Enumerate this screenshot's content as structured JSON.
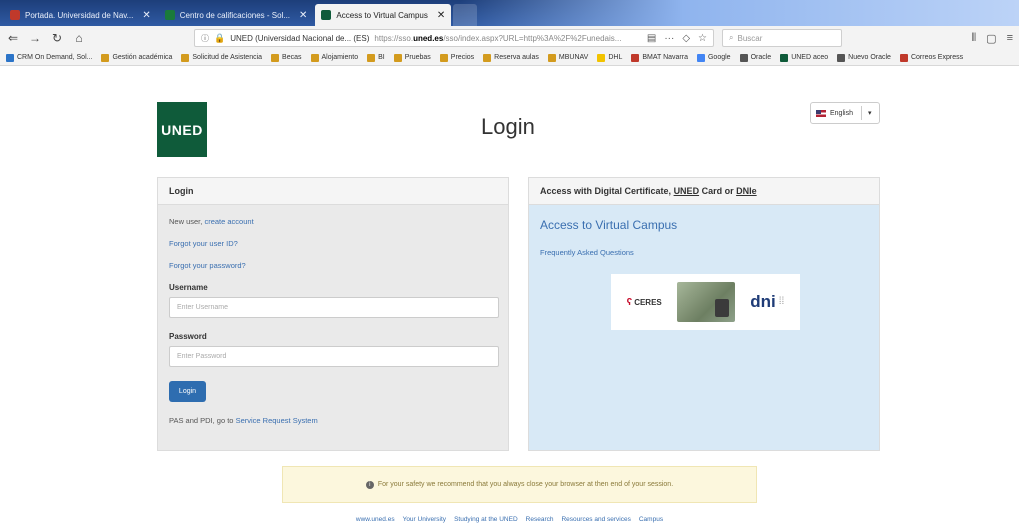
{
  "browser": {
    "tabs": [
      {
        "title": "Portada. Universidad de Nav...",
        "favicon_color": "#c0392b"
      },
      {
        "title": "Centro de calificaciones - Sol...",
        "favicon_color": "#1a7a3a"
      },
      {
        "title": "Access to Virtual Campus",
        "favicon_color": "#0f5b3a"
      }
    ],
    "url": {
      "site": "UNED (Universidad Nacional de... (ES)",
      "prefix": "https://sso.",
      "host": "uned.es",
      "path": "/sso/index.aspx?URL=http%3A%2F%2Funedais..."
    },
    "search_placeholder": "Buscar",
    "bookmarks": [
      {
        "label": "CRM On Demand, Sol...",
        "color": "#2b74c8"
      },
      {
        "label": "Gestión académica",
        "color": "#d39b1e"
      },
      {
        "label": "Solicitud de Asistencia",
        "color": "#d39b1e"
      },
      {
        "label": "Becas",
        "color": "#d39b1e"
      },
      {
        "label": "Alojamiento",
        "color": "#d39b1e"
      },
      {
        "label": "BI",
        "color": "#d39b1e"
      },
      {
        "label": "Pruebas",
        "color": "#d39b1e"
      },
      {
        "label": "Precios",
        "color": "#d39b1e"
      },
      {
        "label": "Reserva aulas",
        "color": "#d39b1e"
      },
      {
        "label": "MBUNAV",
        "color": "#d39b1e"
      },
      {
        "label": "DHL",
        "color": "#f2c300"
      },
      {
        "label": "BMAT Navarra",
        "color": "#c0392b"
      },
      {
        "label": "Google",
        "color": "#4285f4"
      },
      {
        "label": "Oracle",
        "color": "#555555"
      },
      {
        "label": "UNED aceo",
        "color": "#0f5b3a"
      },
      {
        "label": "Nuevo Oracle",
        "color": "#555555"
      },
      {
        "label": "Correos Express",
        "color": "#c0392b"
      }
    ]
  },
  "header": {
    "logo": "UNED",
    "title": "Login",
    "language": "English"
  },
  "login": {
    "panel_title": "Login",
    "new_user_text": "New user,",
    "create_account": "create account",
    "forgot_user": "Forgot your user ID?",
    "forgot_password": "Forgot your password?",
    "username_label": "Username",
    "username_placeholder": "Enter Username",
    "password_label": "Password",
    "password_placeholder": "Enter Password",
    "button": "Login",
    "pas_text": "PAS and PDI, go to",
    "service_link": "Service Request System"
  },
  "access": {
    "title_prefix": "Access with Digital Certificate,",
    "title_uned": "UNED",
    "title_middle": "Card or",
    "title_dni": "DNIe",
    "virtual_campus": "Access to Virtual Campus",
    "faq": "Frequently Asked Questions",
    "ceres": "CERES",
    "dni": "dni"
  },
  "notice": "For your safety we recommend that you always close your browser at then end of your session.",
  "footer": [
    "www.uned.es",
    "Your University",
    "Studying at the UNED",
    "Research",
    "Resources and services",
    "Campus"
  ]
}
